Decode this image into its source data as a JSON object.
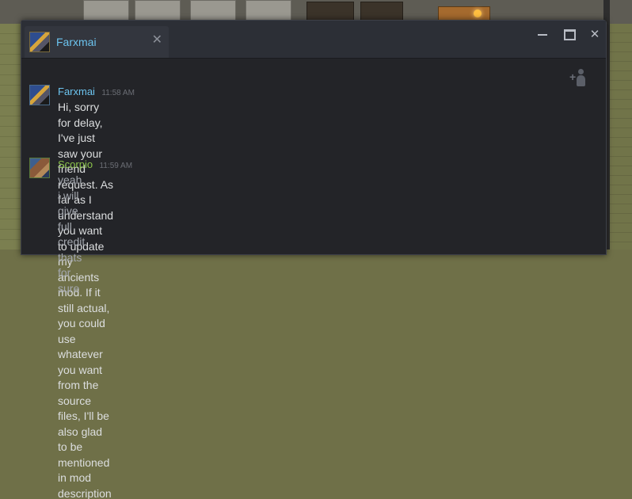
{
  "window": {
    "tab": {
      "name": "Farxmai"
    }
  },
  "messages": [
    {
      "sender": "Farxmai",
      "time": "11:58 AM",
      "lines": [
        "Hi, sorry for delay, I've just saw your friend request. As far as I understand you want to update my",
        "ancients mod. If it still actual, you could use whatever you want from the source files, I'll be also glad",
        "to be mentioned in mod description"
      ]
    },
    {
      "sender": "Scorpio",
      "time": "11:59 AM",
      "lines": [
        "yeah i will give full credit thats for sure"
      ]
    }
  ],
  "colors": {
    "friend_name": "#6cc4ef",
    "ingame_name": "#8bc34a",
    "window_bg": "#222429"
  }
}
